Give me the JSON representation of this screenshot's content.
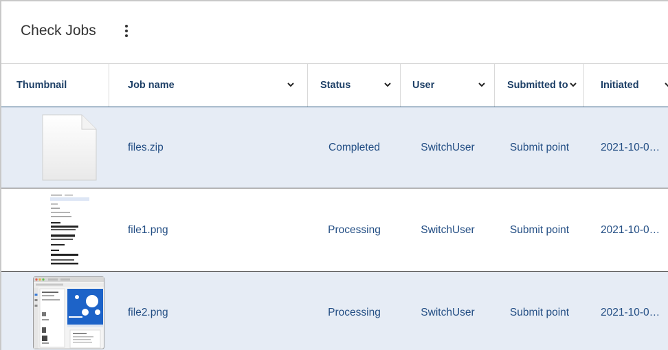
{
  "page": {
    "title": "Check Jobs",
    "menu_icon": "kebab-menu-icon"
  },
  "table": {
    "columns": [
      {
        "key": "thumbnail",
        "label": "Thumbnail",
        "sortable": false
      },
      {
        "key": "job_name",
        "label": "Job name",
        "sortable": true
      },
      {
        "key": "status",
        "label": "Status",
        "sortable": true
      },
      {
        "key": "user",
        "label": "User",
        "sortable": true
      },
      {
        "key": "submitted_to",
        "label": "Submitted to",
        "sortable": true
      },
      {
        "key": "initiated",
        "label": "Initiated",
        "sortable": true
      }
    ],
    "rows": [
      {
        "thumbnail": "blank-file-icon",
        "job_name": "files.zip",
        "status": "Completed",
        "user": "SwitchUser",
        "submitted_to": "Submit point",
        "initiated": "2021-10-0…"
      },
      {
        "thumbnail": "text-document-preview",
        "job_name": "file1.png",
        "status": "Processing",
        "user": "SwitchUser",
        "submitted_to": "Submit point",
        "initiated": "2021-10-0…"
      },
      {
        "thumbnail": "app-window-preview",
        "job_name": "file2.png",
        "status": "Processing",
        "user": "SwitchUser",
        "submitted_to": "Submit point",
        "initiated": "2021-10-0…"
      }
    ]
  },
  "colors": {
    "header_text": "#1d3f66",
    "link_text": "#234e84",
    "selected_row": "#e6ecf5",
    "header_rule": "#1f4f7a"
  }
}
